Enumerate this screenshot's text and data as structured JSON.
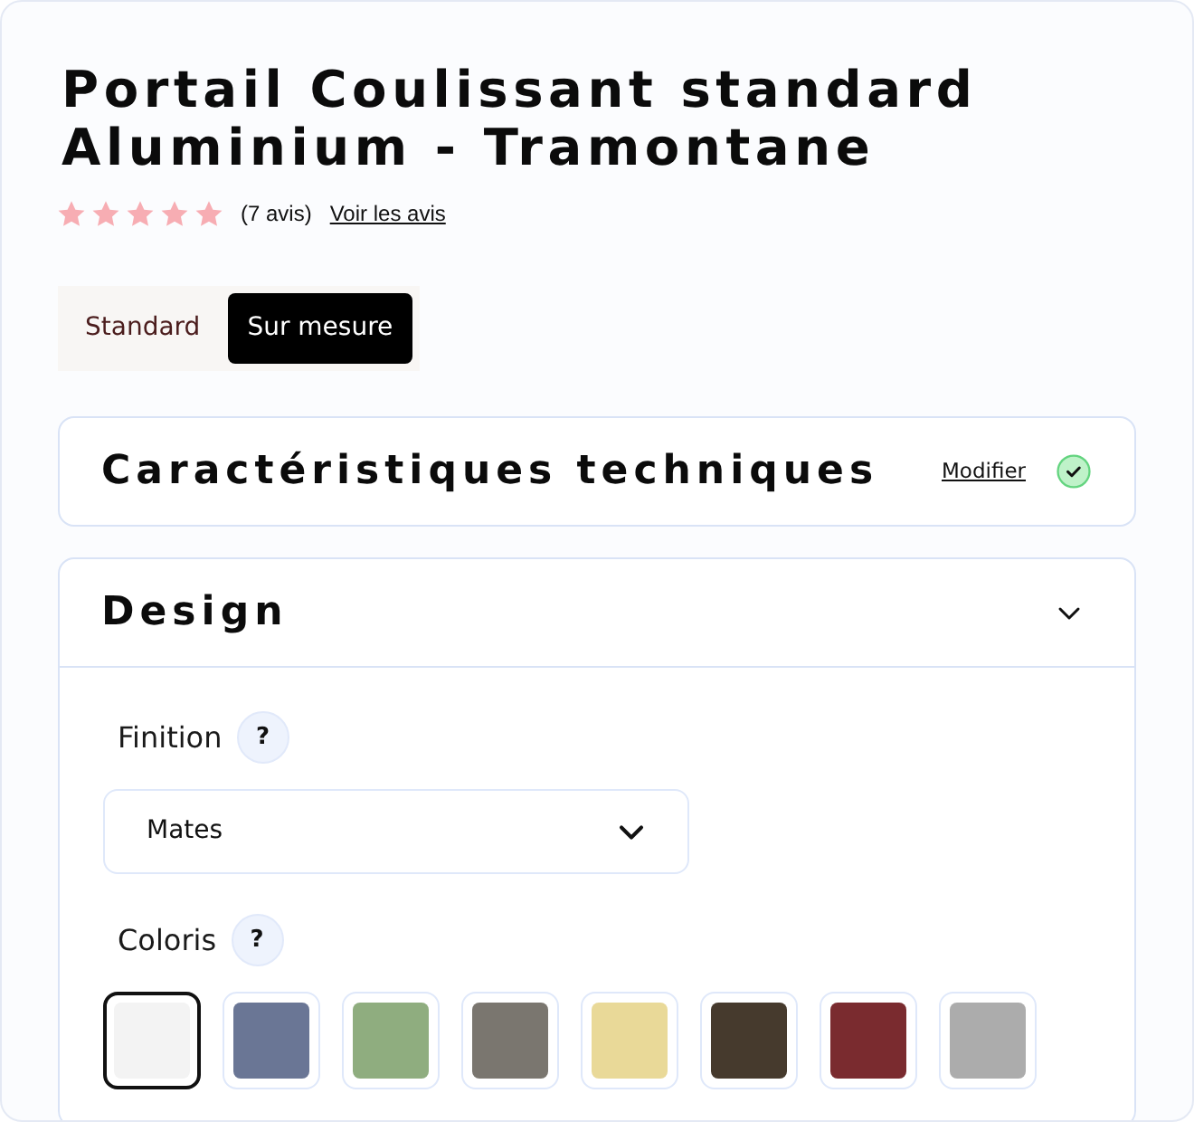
{
  "product": {
    "title": "Portail Coulissant standard Aluminium - Tramontane",
    "stars": 5,
    "review_count": "(7 avis)",
    "reviews_link": "Voir les avis"
  },
  "tabs": [
    {
      "label": "Standard",
      "selected": false
    },
    {
      "label": "Sur mesure",
      "selected": true
    }
  ],
  "sections": [
    {
      "title": "Caractéristiques techniques",
      "completed": true,
      "edit_link": "Modifier"
    },
    {
      "title": "Design",
      "expanded": true,
      "fields": [
        {
          "kind": "select",
          "label": "Finition",
          "help": "?",
          "value": "Mates"
        },
        {
          "kind": "swatches",
          "label": "Coloris",
          "help": "?",
          "swatches": [
            {
              "color": "#f3f3f3",
              "selected": true
            },
            {
              "color": "#6a7695",
              "selected": false
            },
            {
              "color": "#8fad7f",
              "selected": false
            },
            {
              "color": "#7a766f",
              "selected": false
            },
            {
              "color": "#e9d998",
              "selected": false
            },
            {
              "color": "#463a2d",
              "selected": false
            },
            {
              "color": "#7a2b2f",
              "selected": false
            },
            {
              "color": "#acacac",
              "selected": false
            }
          ]
        }
      ]
    }
  ]
}
